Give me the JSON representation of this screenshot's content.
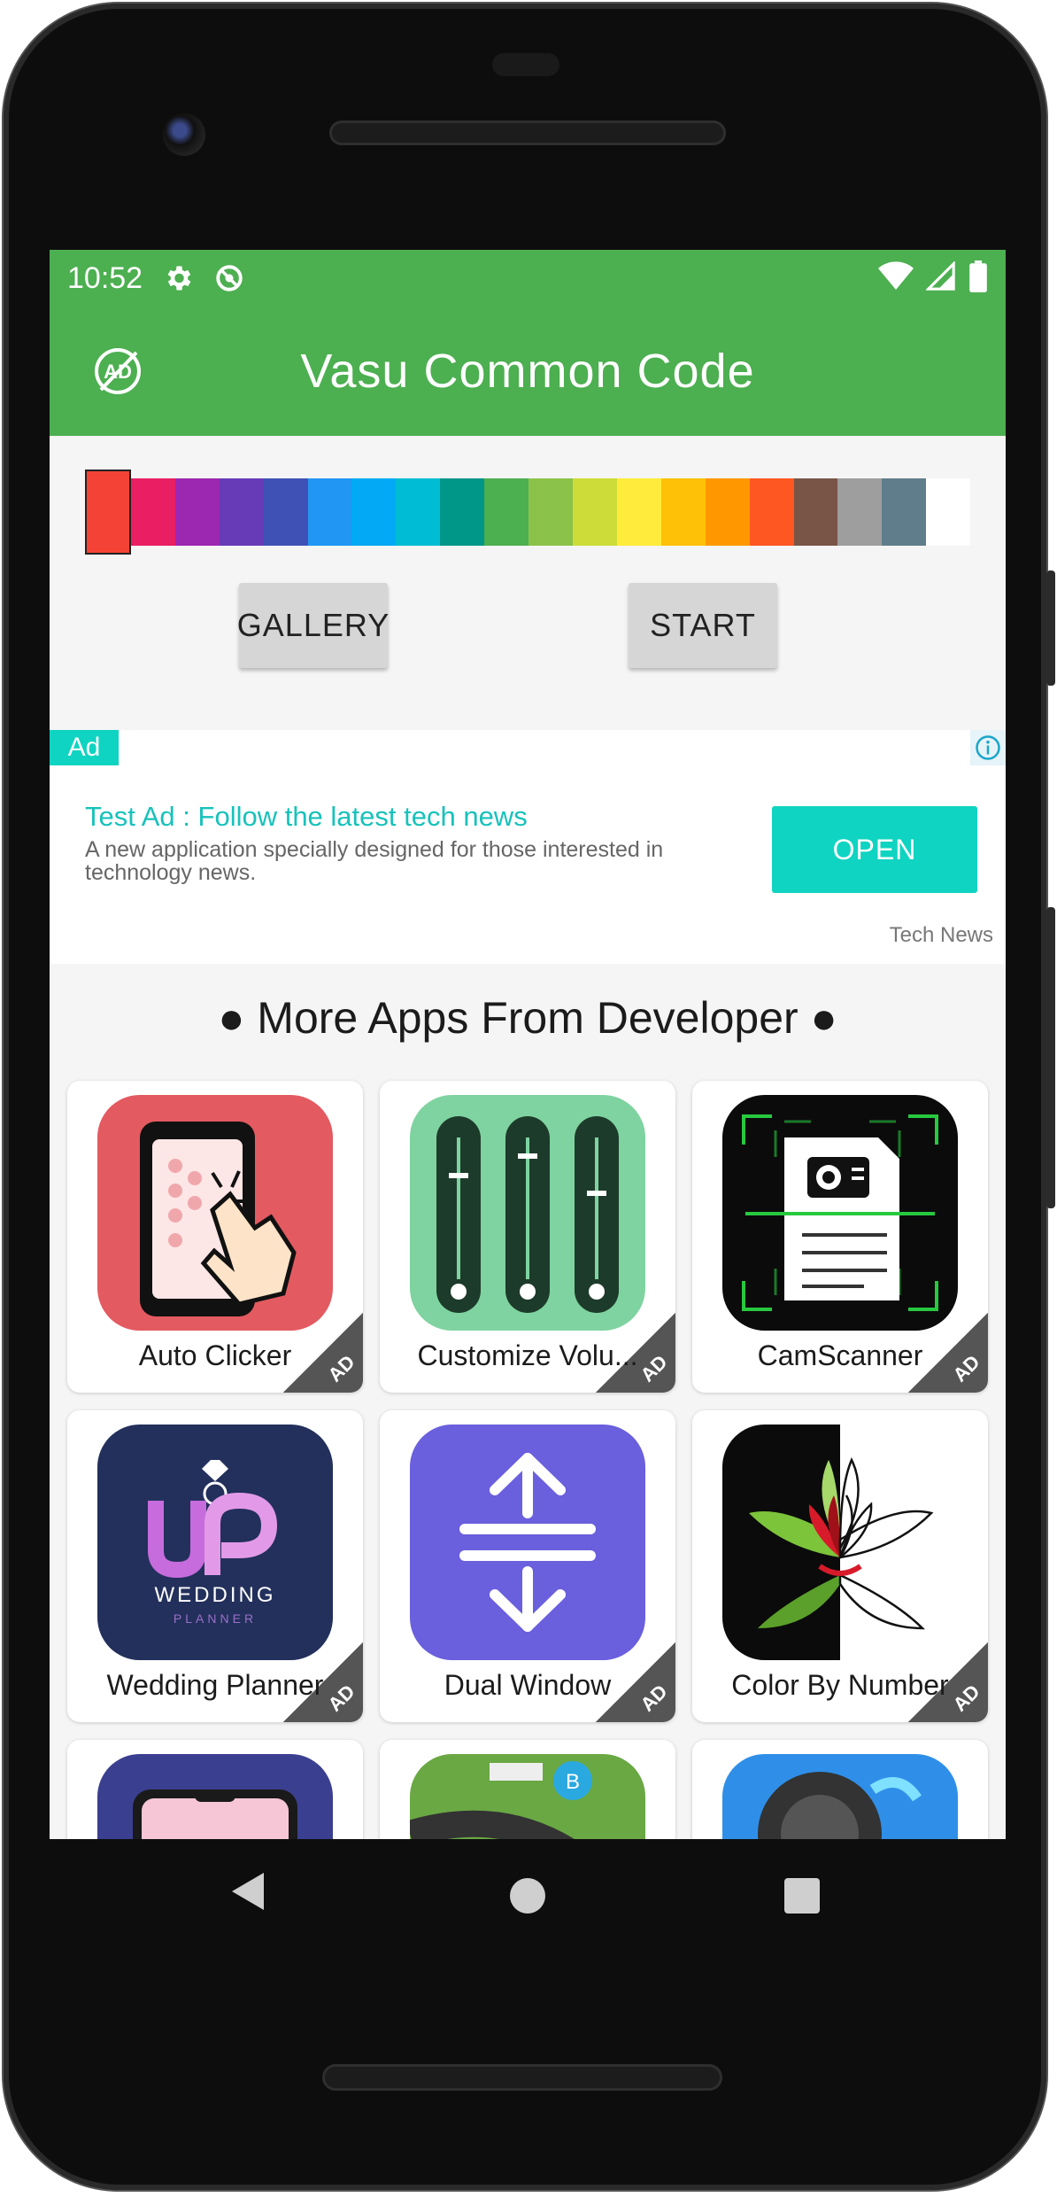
{
  "status_bar": {
    "time": "10:52",
    "icons": [
      "gear-icon",
      "sync-off-icon",
      "wifi-icon",
      "signal-icon",
      "battery-icon"
    ]
  },
  "app_bar": {
    "title": "Vasu Common Code",
    "left_icon": "no-ads-icon",
    "color": "#4caf50"
  },
  "palette": {
    "colors": [
      "#f44336",
      "#e91e63",
      "#9c27b0",
      "#673ab7",
      "#3f51b5",
      "#2196f3",
      "#03a9f4",
      "#00bcd4",
      "#009688",
      "#4caf50",
      "#8bc34a",
      "#cddc39",
      "#ffeb3b",
      "#ffc107",
      "#ff9800",
      "#ff5722",
      "#795548",
      "#9e9e9e",
      "#607d8b",
      "#ffffff"
    ],
    "selected_index": 0
  },
  "buttons": {
    "gallery": "GALLERY",
    "start": "START"
  },
  "ad": {
    "badge": "Ad",
    "headline": "Test Ad : Follow the latest tech news",
    "body": "A new application specially designed for those interested in technology news.",
    "cta": "OPEN",
    "advertiser": "Tech News",
    "accent": "#0fd4c1"
  },
  "more_apps": {
    "title": "● More Apps From Developer ●",
    "ad_label": "AD",
    "apps": [
      {
        "name": "Auto Clicker"
      },
      {
        "name": "Customize Volu..."
      },
      {
        "name": "CamScanner"
      },
      {
        "name": "Wedding Planner",
        "icon_text": "WEDDING",
        "icon_subtext": "PLANNER"
      },
      {
        "name": "Dual Window"
      },
      {
        "name": "Color By Number"
      }
    ]
  },
  "navigation": {
    "back": "back-icon",
    "home": "home-icon",
    "recents": "recents-icon"
  }
}
